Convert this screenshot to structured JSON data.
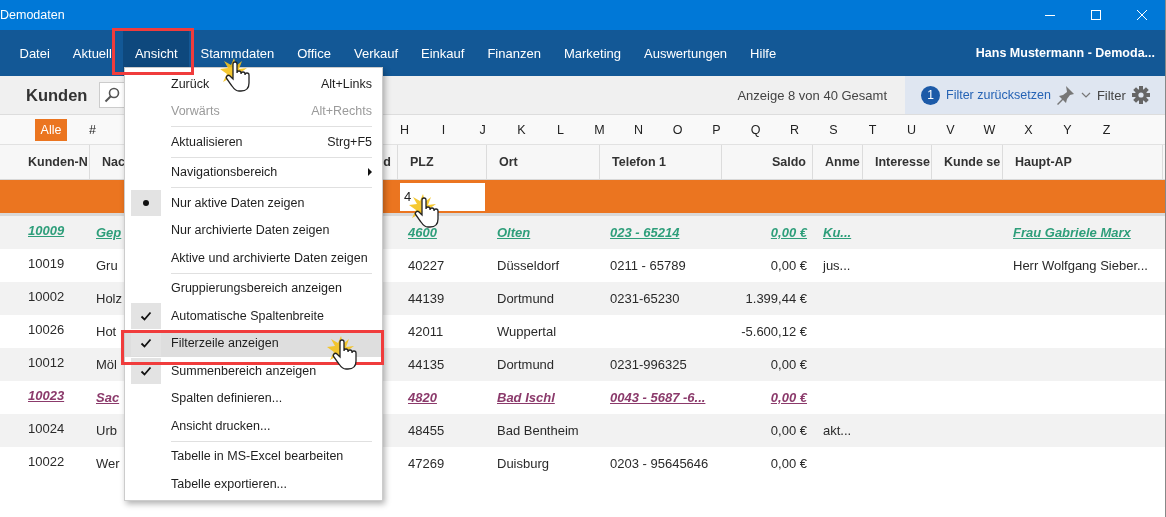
{
  "window": {
    "title": "Demodaten"
  },
  "menu_bar": {
    "items": [
      {
        "label": "Datei",
        "selected": false
      },
      {
        "label": "Aktuell",
        "selected": false
      },
      {
        "label": "Ansicht",
        "selected": true
      },
      {
        "label": "Stammdaten",
        "selected": false
      },
      {
        "label": "Office",
        "selected": false
      },
      {
        "label": "Verkauf",
        "selected": false
      },
      {
        "label": "Einkauf",
        "selected": false
      },
      {
        "label": "Finanzen",
        "selected": false
      },
      {
        "label": "Marketing",
        "selected": false
      },
      {
        "label": "Auswertungen",
        "selected": false
      },
      {
        "label": "Hilfe",
        "selected": false
      }
    ],
    "user": "Hans Mustermann - Demoda..."
  },
  "toolbar": {
    "title": "Kunden",
    "record_count": "Anzeige 8 von 40 Gesamt",
    "filter_count": "1",
    "reset_filter": "Filter zurücksetzen",
    "filter_label": "Filter"
  },
  "alphabet": {
    "items": [
      {
        "label": "Alle",
        "selected": true
      },
      {
        "label": "#",
        "selected": false
      },
      {
        "label": "H",
        "selected": false
      },
      {
        "label": "I",
        "selected": false
      },
      {
        "label": "J",
        "selected": false
      },
      {
        "label": "K",
        "selected": false
      },
      {
        "label": "L",
        "selected": false
      },
      {
        "label": "M",
        "selected": false
      },
      {
        "label": "N",
        "selected": false
      },
      {
        "label": "O",
        "selected": false
      },
      {
        "label": "P",
        "selected": false
      },
      {
        "label": "Q",
        "selected": false
      },
      {
        "label": "R",
        "selected": false
      },
      {
        "label": "S",
        "selected": false
      },
      {
        "label": "T",
        "selected": false
      },
      {
        "label": "U",
        "selected": false
      },
      {
        "label": "V",
        "selected": false
      },
      {
        "label": "W",
        "selected": false
      },
      {
        "label": "X",
        "selected": false
      },
      {
        "label": "Y",
        "selected": false
      },
      {
        "label": "Z",
        "selected": false
      }
    ]
  },
  "table": {
    "columns": [
      {
        "label": "Kunden-N",
        "kind": "text"
      },
      {
        "label": "Nac",
        "kind": "text"
      },
      {
        "label": "d",
        "kind": "amount"
      },
      {
        "label": "PLZ",
        "kind": "text",
        "filter": "4"
      },
      {
        "label": "Ort",
        "kind": "text"
      },
      {
        "label": "Telefon 1",
        "kind": "text"
      },
      {
        "label": "Saldo",
        "kind": "amount"
      },
      {
        "label": "Anme",
        "kind": "text"
      },
      {
        "label": "Interesse",
        "kind": "text"
      },
      {
        "label": "Kunde se",
        "kind": "text"
      },
      {
        "label": "Haupt-AP",
        "kind": "text"
      }
    ],
    "rows": [
      {
        "kind": "link",
        "color": "#2e9e7a",
        "cells": [
          "10009",
          "Gep",
          null,
          "4600",
          "Olten",
          "023 - 65214",
          "0,00 €",
          "Ku...",
          null,
          null,
          "Frau Gabriele Marx"
        ]
      },
      {
        "kind": "plain",
        "cells": [
          "10019",
          "Gru",
          null,
          "40227",
          "Düsseldorf",
          "0211 - 65789",
          "0,00 €",
          "jus...",
          null,
          null,
          "Herr Wolfgang Sieber..."
        ]
      },
      {
        "kind": "plain",
        "cells": [
          "10002",
          "Holz",
          null,
          "44139",
          "Dortmund",
          "0231-65230",
          "1.399,44 €",
          null,
          null,
          null,
          null
        ]
      },
      {
        "kind": "plain",
        "cells": [
          "10026",
          "Hot",
          null,
          "42011",
          "Wuppertal",
          null,
          "-5.600,12 €",
          null,
          null,
          null,
          null
        ]
      },
      {
        "kind": "plain",
        "cells": [
          "10012",
          "Möl",
          null,
          "44135",
          "Dortmund",
          "0231-996325",
          "0,00 €",
          null,
          null,
          null,
          null
        ]
      },
      {
        "kind": "link",
        "color": "#8b3a6b",
        "cells": [
          "10023",
          "Sac",
          null,
          "4820",
          "Bad Ischl",
          "0043 - 5687 -6...",
          "0,00 €",
          null,
          null,
          null,
          null
        ]
      },
      {
        "kind": "plain",
        "cells": [
          "10024",
          "Urb",
          null,
          "48455",
          "Bad Bentheim",
          null,
          "0,00 €",
          "akt...",
          null,
          null,
          null
        ]
      },
      {
        "kind": "plain",
        "cells": [
          "10022",
          "Wer",
          null,
          "47269",
          "Duisburg",
          "0203 - 95645646",
          "0,00 €",
          null,
          null,
          null,
          null
        ]
      }
    ]
  },
  "context_menu": {
    "items": [
      {
        "kind": "item",
        "label": "Zurück",
        "shortcut": "Alt+Links",
        "disabled": false,
        "highlighted": false
      },
      {
        "kind": "item",
        "label": "Vorwärts",
        "shortcut": "Alt+Rechts",
        "disabled": true,
        "highlighted": false
      },
      {
        "kind": "separator"
      },
      {
        "kind": "item",
        "label": "Aktualisieren",
        "shortcut": "Strg+F5",
        "disabled": false,
        "highlighted": false
      },
      {
        "kind": "separator"
      },
      {
        "kind": "submenu",
        "label": "Navigationsbereich",
        "disabled": false,
        "highlighted": false
      },
      {
        "kind": "separator"
      },
      {
        "kind": "radio",
        "label": "Nur aktive Daten zeigen",
        "selected": true,
        "disabled": false,
        "highlighted": false
      },
      {
        "kind": "radio",
        "label": "Nur archivierte Daten zeigen",
        "selected": false,
        "disabled": false,
        "highlighted": false
      },
      {
        "kind": "radio",
        "label": "Aktive und archivierte Daten zeigen",
        "selected": false,
        "disabled": false,
        "highlighted": false
      },
      {
        "kind": "separator"
      },
      {
        "kind": "check",
        "label": "Gruppierungsbereich anzeigen",
        "checked": false,
        "disabled": false,
        "highlighted": false
      },
      {
        "kind": "check",
        "label": "Automatische Spaltenbreite",
        "checked": true,
        "disabled": false,
        "highlighted": false
      },
      {
        "kind": "check",
        "label": "Filterzeile anzeigen",
        "checked": true,
        "disabled": false,
        "highlighted": true
      },
      {
        "kind": "check",
        "label": "Summenbereich anzeigen",
        "checked": true,
        "disabled": false,
        "highlighted": false
      },
      {
        "kind": "item",
        "label": "Spalten definieren...",
        "disabled": false,
        "highlighted": false
      },
      {
        "kind": "item",
        "label": "Ansicht drucken...",
        "disabled": false,
        "highlighted": false
      },
      {
        "kind": "separator"
      },
      {
        "kind": "item",
        "label": "Tabelle in MS-Excel bearbeiten",
        "disabled": false,
        "highlighted": false
      },
      {
        "kind": "item",
        "label": "Tabelle exportieren...",
        "disabled": false,
        "highlighted": false
      }
    ]
  }
}
